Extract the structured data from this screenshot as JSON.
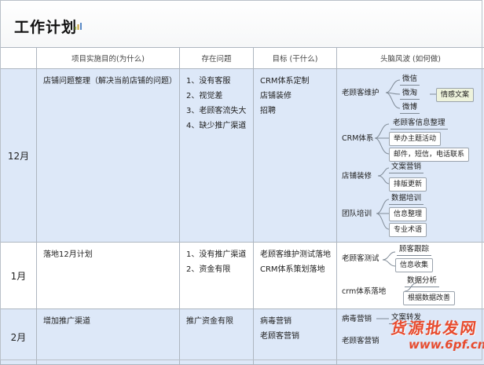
{
  "title": "工作计划",
  "columns": [
    "",
    "项目实施目的(为什么)",
    "存在问题",
    "目标 (干什么)",
    "头脑风波 (如何做)"
  ],
  "rows": [
    {
      "month": "12月",
      "purpose": "店铺问题整理（解决当前店铺的问题）",
      "problems": [
        "1、没有客服",
        "2、视觉差",
        "3、老顾客流失大",
        "4、缺少推广渠道"
      ],
      "goals": [
        "CRM体系定制",
        "店铺装修",
        "招聘"
      ],
      "mindmap": {
        "old_customer": "老顾客维护",
        "weixin": "微信",
        "weitao": "微淘",
        "weibo": "微博",
        "emotional_copy": "情感文案",
        "crm": "CRM体系",
        "crm_info": "老顾客信息整理",
        "crm_event": "举办主题活动",
        "crm_contact": "邮件，短信，电话联系",
        "decor": "店铺装修",
        "decor_copy": "文案营销",
        "decor_layout": "排版更新",
        "team": "团队培训",
        "team_data": "数据培训",
        "team_info": "信息整理",
        "team_terms": "专业术语"
      }
    },
    {
      "month": "1月",
      "purpose": "落地12月计划",
      "problems": [
        "1、没有推广渠道",
        "2、资金有限"
      ],
      "goals": [
        "老顾客维护测试落地",
        "CRM体系策划落地"
      ],
      "mindmap": {
        "test": "老顾客测试",
        "followup": "顾客跟踪",
        "collect": "信息收集",
        "crm_land": "crm体系落地",
        "analysis": "数据分析",
        "improve": "根据数据改善"
      }
    },
    {
      "month": "2月",
      "purpose": "增加推广渠道",
      "problems": [
        "推广资金有限"
      ],
      "goals": [
        "病毒营销",
        "老顾客营销"
      ],
      "mindmap": {
        "viral": "病毒营销",
        "viral_leaf": "文案转发",
        "old": "老顾客营销"
      }
    }
  ],
  "watermark": {
    "brand": "货源批发网",
    "site": "www.6pf.cn"
  }
}
